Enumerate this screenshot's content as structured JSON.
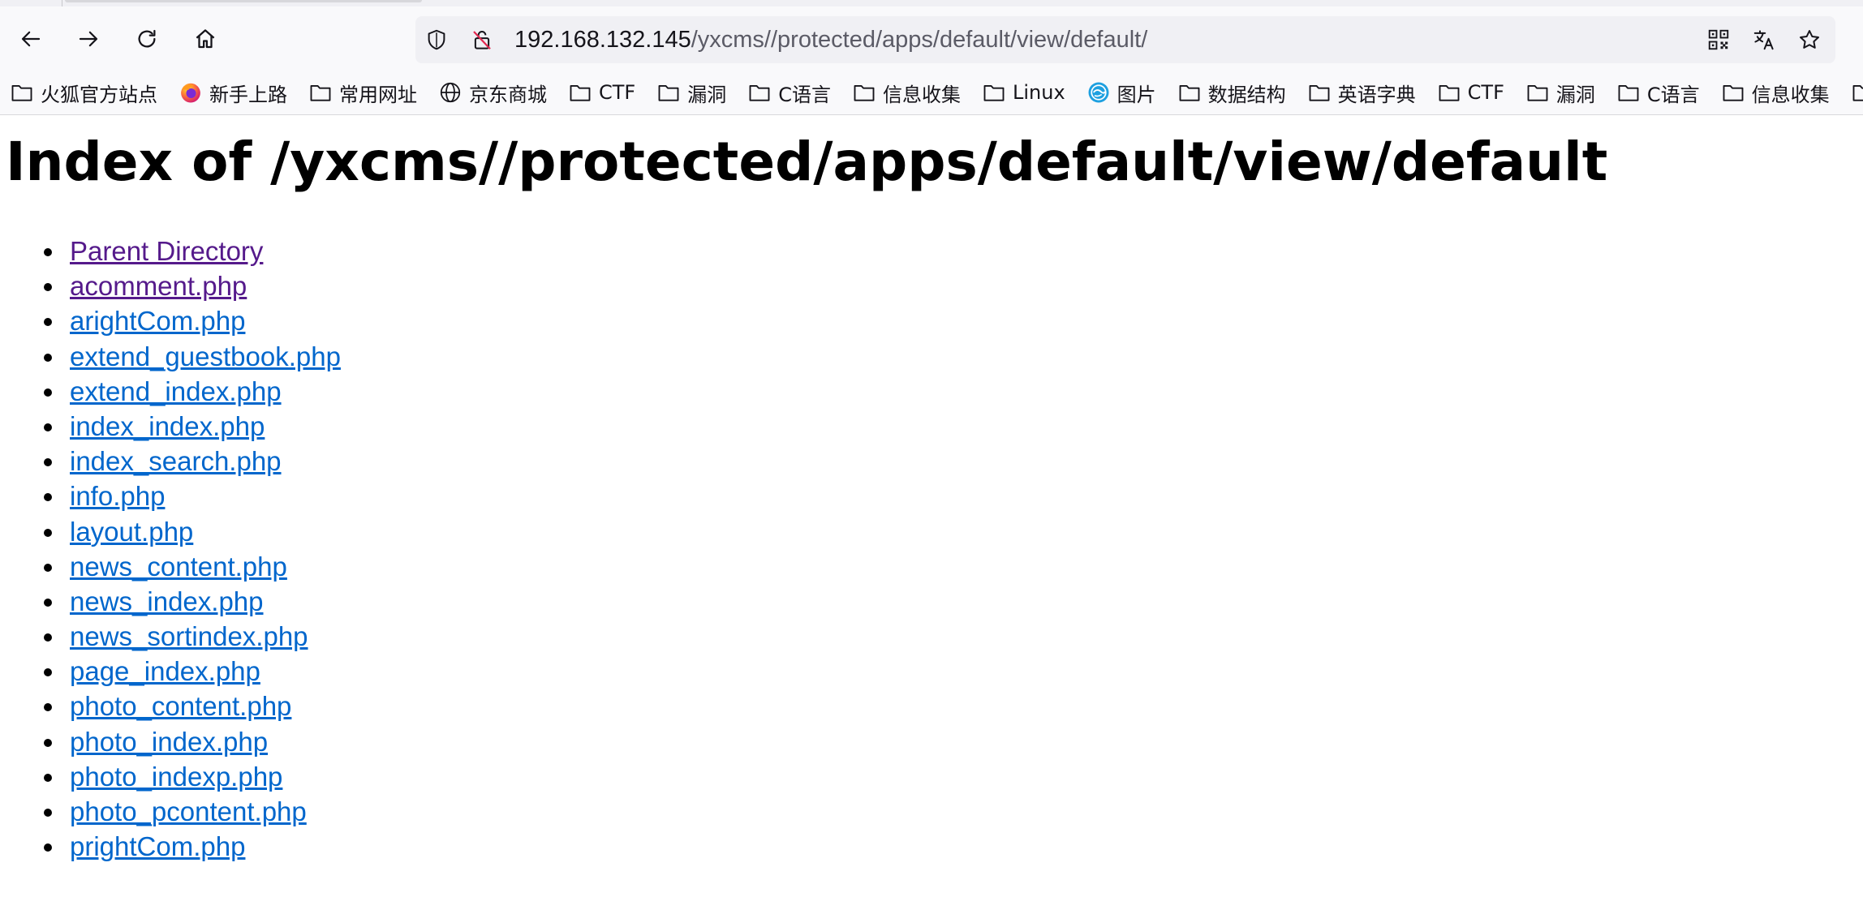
{
  "browser": {
    "url_host": "192.168.132.145",
    "url_path": "/yxcms//protected/apps/default/view/default/",
    "bookmarks": [
      {
        "label": "火狐官方站点",
        "icon": "folder-icon"
      },
      {
        "label": "新手上路",
        "icon": "firefox-icon"
      },
      {
        "label": "常用网址",
        "icon": "folder-icon"
      },
      {
        "label": "京东商城",
        "icon": "globe-icon"
      },
      {
        "label": "CTF",
        "icon": "folder-icon"
      },
      {
        "label": "漏洞",
        "icon": "folder-icon"
      },
      {
        "label": "C语言",
        "icon": "folder-icon"
      },
      {
        "label": "信息收集",
        "icon": "folder-icon"
      },
      {
        "label": "Linux",
        "icon": "folder-icon"
      },
      {
        "label": "图片",
        "icon": "image-search-icon"
      },
      {
        "label": "数据结构",
        "icon": "folder-icon"
      },
      {
        "label": "英语字典",
        "icon": "folder-icon"
      },
      {
        "label": "CTF",
        "icon": "folder-icon"
      },
      {
        "label": "漏洞",
        "icon": "folder-icon"
      },
      {
        "label": "C语言",
        "icon": "folder-icon"
      },
      {
        "label": "信息收集",
        "icon": "folder-icon"
      },
      {
        "label": "",
        "icon": "folder-icon"
      }
    ]
  },
  "page": {
    "title": "Index of /yxcms//protected/apps/default/view/default",
    "entries": [
      {
        "label": "Parent Directory",
        "visited": true
      },
      {
        "label": "acomment.php",
        "visited": true
      },
      {
        "label": "arightCom.php",
        "visited": false
      },
      {
        "label": "extend_guestbook.php",
        "visited": false
      },
      {
        "label": "extend_index.php",
        "visited": false
      },
      {
        "label": "index_index.php",
        "visited": false
      },
      {
        "label": "index_search.php",
        "visited": false
      },
      {
        "label": "info.php",
        "visited": false
      },
      {
        "label": "layout.php",
        "visited": false
      },
      {
        "label": "news_content.php",
        "visited": false
      },
      {
        "label": "news_index.php",
        "visited": false
      },
      {
        "label": "news_sortindex.php",
        "visited": false
      },
      {
        "label": "page_index.php",
        "visited": false
      },
      {
        "label": "photo_content.php",
        "visited": false
      },
      {
        "label": "photo_index.php",
        "visited": false
      },
      {
        "label": "photo_indexp.php",
        "visited": false
      },
      {
        "label": "photo_pcontent.php",
        "visited": false
      },
      {
        "label": "prightCom.php",
        "visited": false
      }
    ]
  },
  "colors": {
    "link": "#0066cc",
    "visited_link": "#551a8b",
    "toolbar_bg": "#f9f9fb",
    "urlbar_bg": "#f0f0f4"
  }
}
